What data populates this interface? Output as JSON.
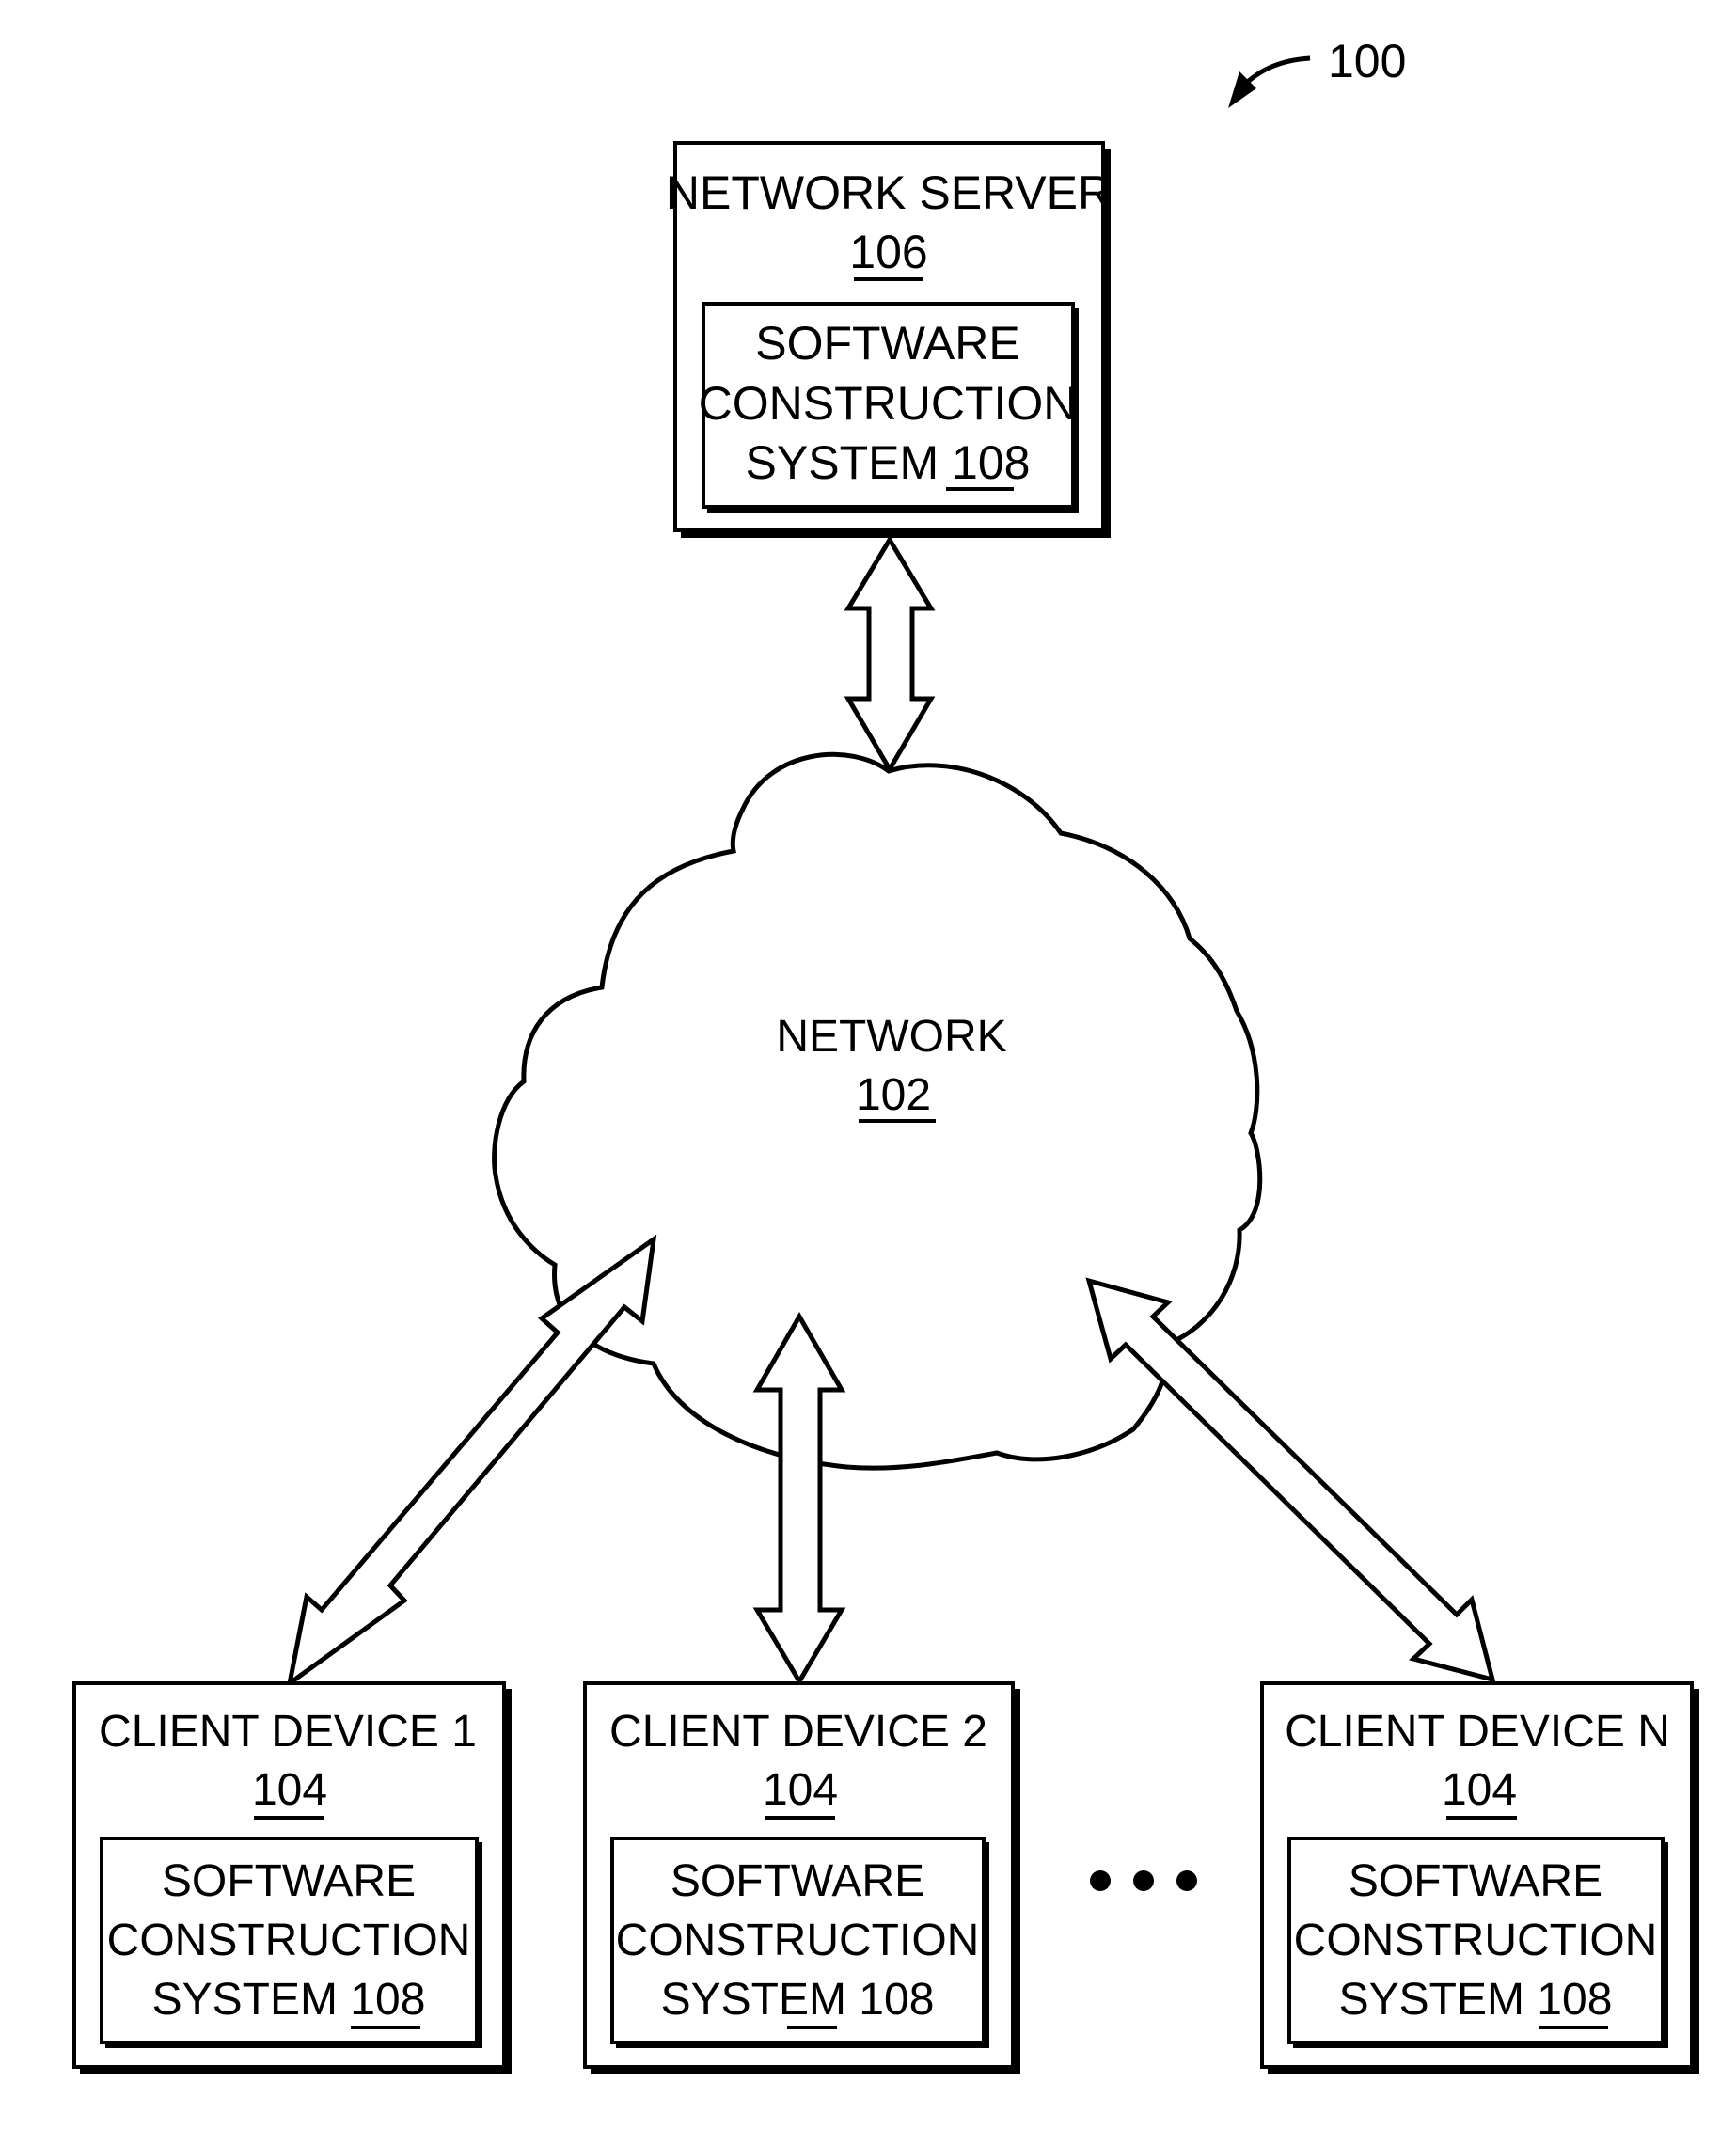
{
  "figure": {
    "ref_label": "100",
    "network_server": {
      "title": "NETWORK SERVER",
      "ref": "106",
      "subsystem": {
        "line1": "SOFTWARE",
        "line2": "CONSTRUCTION",
        "line3_text": "SYSTEM ",
        "ref": "108"
      }
    },
    "network": {
      "title": "NETWORK",
      "ref": "102"
    },
    "clients": [
      {
        "title": "CLIENT DEVICE 1",
        "ref": "104",
        "subsystem": {
          "line1": "SOFTWARE",
          "line2": "CONSTRUCTION",
          "line3_text": "SYSTEM ",
          "ref": "108"
        }
      },
      {
        "title": "CLIENT DEVICE 2",
        "ref": "104",
        "subsystem": {
          "line1": "SOFTWARE",
          "line2": "CONSTRUCTION",
          "line3_text": "SYSTEM ",
          "ref": "108"
        }
      },
      {
        "title": "CLIENT DEVICE N",
        "ref": "104",
        "subsystem": {
          "line1": "SOFTWARE",
          "line2": "CONSTRUCTION",
          "line3_text": "SYSTEM ",
          "ref": "108"
        }
      }
    ],
    "ellipsis_icon": "ellipsis-dots",
    "connections": [
      {
        "from": "network-server",
        "to": "network",
        "type": "bidirectional"
      },
      {
        "from": "network",
        "to": "client-device-1",
        "type": "bidirectional"
      },
      {
        "from": "network",
        "to": "client-device-2",
        "type": "bidirectional"
      },
      {
        "from": "network",
        "to": "client-device-n",
        "type": "bidirectional"
      }
    ]
  }
}
